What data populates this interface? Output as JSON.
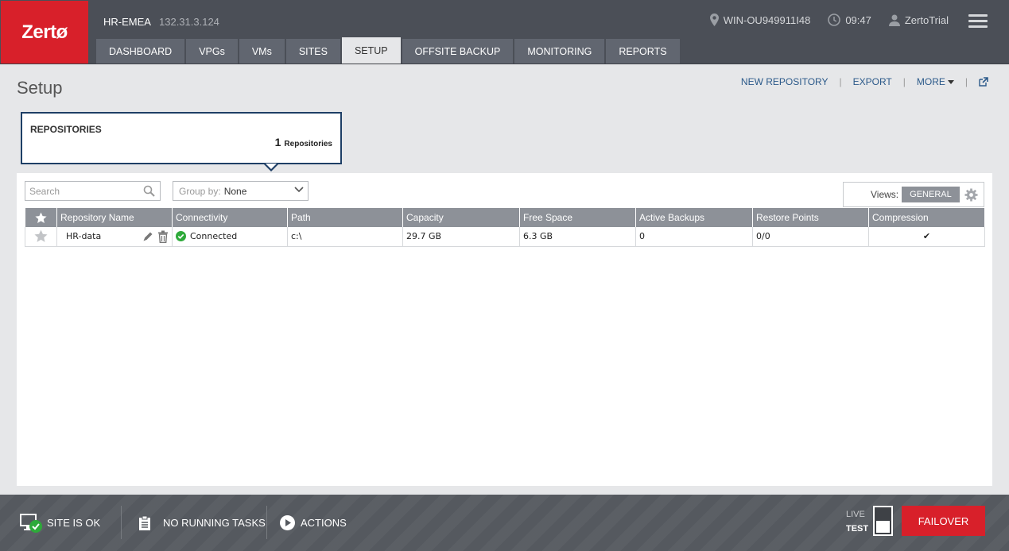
{
  "app": {
    "logo": "Zertø",
    "site_name": "HR-EMEA",
    "site_ip": "132.31.3.124",
    "host": "WIN-OU949911I48",
    "time": "09:47",
    "user": "ZertoTrial"
  },
  "tabs": [
    {
      "label": "DASHBOARD"
    },
    {
      "label": "VPGs"
    },
    {
      "label": "VMs"
    },
    {
      "label": "SITES"
    },
    {
      "label": "SETUP"
    },
    {
      "label": "OFFSITE BACKUP"
    },
    {
      "label": "MONITORING"
    },
    {
      "label": "REPORTS"
    }
  ],
  "active_tab": "SETUP",
  "page": {
    "title": "Setup",
    "actions": {
      "new_repository": "NEW REPOSITORY",
      "export": "EXPORT",
      "more": "MORE"
    }
  },
  "summary_card": {
    "title": "REPOSITORIES",
    "count": "1",
    "count_label": "Repositories"
  },
  "toolbar": {
    "search_placeholder": "Search",
    "group_by_label": "Group by:",
    "group_by_value": "None",
    "views_label": "Views:",
    "views_button": "GENERAL"
  },
  "table": {
    "columns": [
      "Repository Name",
      "Connectivity",
      "Path",
      "Capacity",
      "Free Space",
      "Active Backups",
      "Restore Points",
      "Compression"
    ],
    "rows": [
      {
        "name": "HR-data",
        "connectivity": "Connected",
        "path": "c:\\",
        "capacity": "29.7 GB",
        "free_space": "6.3 GB",
        "active_backups": "0",
        "restore_points": "0/0",
        "compression": "✔"
      }
    ]
  },
  "statusbar": {
    "site_status": "SITE IS OK",
    "tasks": "NO RUNNING TASKS",
    "actions": "ACTIONS",
    "live": "LIVE",
    "test": "TEST",
    "failover": "FAILOVER"
  },
  "colors": {
    "brand_red": "#d8202a",
    "topbar": "#4b4f57",
    "tab": "#616670",
    "header_gray": "#8d9198",
    "link_blue": "#2c5a8a",
    "card_border": "#1e3f66",
    "ok_green": "#2eaa3a"
  }
}
